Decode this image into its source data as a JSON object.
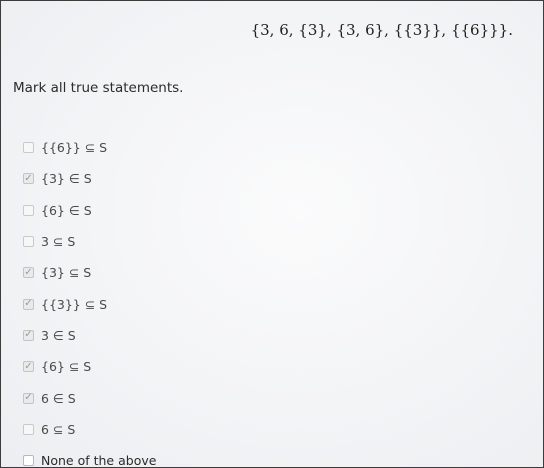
{
  "question": {
    "set_definition": "{3, 6, {3}, {3, 6}, {{3}}, {{6}}}.",
    "prompt": "Mark all true statements."
  },
  "options": [
    {
      "label": "{{6}} ⊆ S",
      "checked": false,
      "enabled": false
    },
    {
      "label": "{3} ∈ S",
      "checked": true,
      "enabled": false
    },
    {
      "label": "{6} ∈ S",
      "checked": false,
      "enabled": false
    },
    {
      "label": "3 ⊆ S",
      "checked": false,
      "enabled": false
    },
    {
      "label": "{3} ⊆ S",
      "checked": true,
      "enabled": false
    },
    {
      "label": "{{3}} ⊆ S",
      "checked": true,
      "enabled": false
    },
    {
      "label": "3 ∈ S",
      "checked": true,
      "enabled": false
    },
    {
      "label": "{6} ⊆ S",
      "checked": true,
      "enabled": false
    },
    {
      "label": "6 ∈ S",
      "checked": true,
      "enabled": false
    },
    {
      "label": "6 ⊆ S",
      "checked": false,
      "enabled": false
    },
    {
      "label": "None of the above",
      "checked": false,
      "enabled": true
    }
  ],
  "icons": {
    "checked_mark": "✓"
  }
}
